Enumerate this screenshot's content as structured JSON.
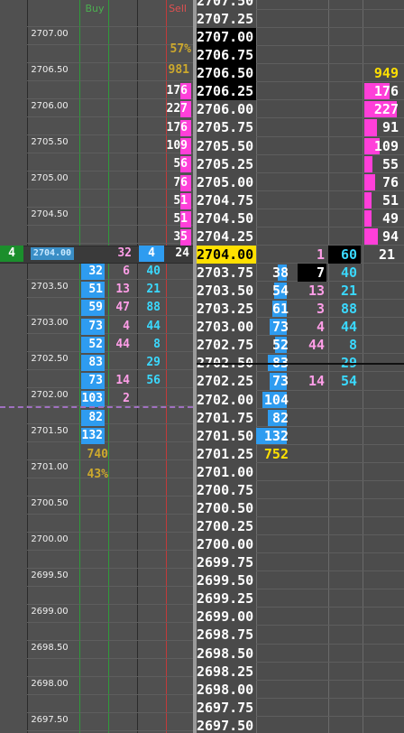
{
  "colors": {
    "buy_bar": "#2e9cf0",
    "sell_bar": "#ff3fd9",
    "current_price": "#ffe000",
    "cyan": "#3ad9ff",
    "pink": "#ff9ee8",
    "gold": "#cda92d"
  },
  "headers": {
    "buy": "Buy",
    "sell": "Sell"
  },
  "left_price_labels": [
    "2707.00",
    "2706.50",
    "2706.00",
    "2705.50",
    "2705.00",
    "2704.50",
    "2704.00",
    "2703.50",
    "2703.00",
    "2702.50",
    "2702.00",
    "2701.50",
    "2701.00",
    "2700.50",
    "2700.00",
    "2699.50",
    "2699.00",
    "2698.50",
    "2698.00",
    "2697.50"
  ],
  "left_current": {
    "marker": "4",
    "price": "2704.00",
    "bid": "32",
    "ask_box": "4",
    "vol": "24"
  },
  "left_summary": {
    "sell_pct": "57%",
    "sell_total": "981",
    "buy_total": "740",
    "buy_pct": "43%"
  },
  "left_sell_rows": [
    "176",
    "227",
    "176",
    "109",
    "56",
    "76",
    "51",
    "51",
    "35"
  ],
  "left_buy_rows": [
    {
      "buy": "32",
      "mid": "6",
      "cy": "40"
    },
    {
      "buy": "51",
      "mid": "13",
      "cy": "21"
    },
    {
      "buy": "59",
      "mid": "47",
      "cy": "88"
    },
    {
      "buy": "73",
      "mid": "4",
      "cy": "44"
    },
    {
      "buy": "52",
      "mid": "44",
      "cy": "8"
    },
    {
      "buy": "83",
      "mid": "",
      "cy": "29"
    },
    {
      "buy": "73",
      "mid": "14",
      "cy": "56"
    },
    {
      "buy": "103",
      "mid": "2",
      "cy": ""
    },
    {
      "buy": "82",
      "mid": "",
      "cy": ""
    },
    {
      "buy": "132",
      "mid": "",
      "cy": ""
    }
  ],
  "ladder_prices": [
    "2707.50",
    "2707.25",
    "2707.00",
    "2706.75",
    "2706.50",
    "2706.25",
    "2706.00",
    "2705.75",
    "2705.50",
    "2705.25",
    "2705.00",
    "2704.75",
    "2704.50",
    "2704.25",
    "2704.00",
    "2703.75",
    "2703.50",
    "2703.25",
    "2703.00",
    "2702.75",
    "2702.50",
    "2702.25",
    "2702.00",
    "2701.75",
    "2701.50",
    "2701.25",
    "2701.00",
    "2700.75",
    "2700.50",
    "2700.25",
    "2700.00",
    "2699.75",
    "2699.50",
    "2699.25",
    "2699.00",
    "2698.75",
    "2698.50",
    "2698.25",
    "2698.00",
    "2697.75",
    "2697.50"
  ],
  "ladder_asks": [
    {
      "row": 4,
      "v": "949",
      "bar": 0
    },
    {
      "row": 5,
      "v": "176",
      "bar": 0.78
    },
    {
      "row": 6,
      "v": "227",
      "bar": 1.0
    },
    {
      "row": 7,
      "v": "91",
      "bar": 0.4
    },
    {
      "row": 8,
      "v": "109",
      "bar": 0.48
    },
    {
      "row": 9,
      "v": "55",
      "bar": 0.24
    },
    {
      "row": 10,
      "v": "76",
      "bar": 0.33
    },
    {
      "row": 11,
      "v": "51",
      "bar": 0.22
    },
    {
      "row": 12,
      "v": "49",
      "bar": 0.22
    },
    {
      "row": 13,
      "v": "94",
      "bar": 0.41
    }
  ],
  "ladder_current": {
    "row": 14,
    "a": "1",
    "box": "60",
    "last": "21"
  },
  "ladder_bids": [
    {
      "row": 15,
      "b": "38",
      "m": "7",
      "c": "40",
      "bar": 0.29,
      "mdark": true
    },
    {
      "row": 16,
      "b": "54",
      "m": "13",
      "c": "21",
      "bar": 0.41
    },
    {
      "row": 17,
      "b": "61",
      "m": "3",
      "c": "88",
      "bar": 0.46
    },
    {
      "row": 18,
      "b": "73",
      "m": "4",
      "c": "44",
      "bar": 0.55
    },
    {
      "row": 19,
      "b": "52",
      "m": "44",
      "c": "8",
      "bar": 0.39
    },
    {
      "row": 20,
      "b": "83",
      "m": "",
      "c": "29",
      "bar": 0.63
    },
    {
      "row": 21,
      "b": "73",
      "m": "14",
      "c": "54",
      "bar": 0.55
    },
    {
      "row": 22,
      "b": "104",
      "m": "",
      "c": "",
      "bar": 0.79
    },
    {
      "row": 23,
      "b": "82",
      "m": "",
      "c": "",
      "bar": 0.62
    },
    {
      "row": 24,
      "b": "132",
      "m": "",
      "c": "",
      "bar": 1.0
    },
    {
      "row": 25,
      "b": "752",
      "m": "",
      "c": "",
      "bar": 0,
      "gold": true
    }
  ]
}
